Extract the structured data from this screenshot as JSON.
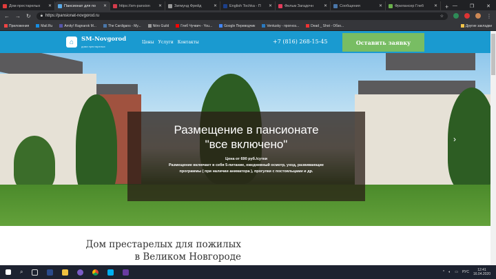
{
  "browser": {
    "tabs": [
      {
        "label": "Дом престарелых",
        "color": "#e03b3b",
        "active": false
      },
      {
        "label": "Пансионат для по",
        "color": "#5aa9e6",
        "active": true
      },
      {
        "label": "https://sm-pansion",
        "color": "#d23b4b",
        "active": false
      },
      {
        "label": "Зигмунд Фрейд",
        "color": "#999999",
        "active": false
      },
      {
        "label": "English Tochka - П",
        "color": "#1c3f8a",
        "active": false
      },
      {
        "label": "Фильм Загадочн",
        "color": "#e33c5b",
        "active": false
      },
      {
        "label": "Сообщения",
        "color": "#4a76a8",
        "active": false
      },
      {
        "label": "Фрилансер Глеб",
        "color": "#6ab04c",
        "active": false
      }
    ],
    "url": "https://pansionat-novgorod.ru",
    "bookmarks": [
      {
        "label": "Приложения",
        "color": "#e44"
      },
      {
        "label": "Mail.Ru",
        "color": "#168de2"
      },
      {
        "label": "Amity! Ragnarok M...",
        "color": "#55a"
      },
      {
        "label": "The Cardigans - My...",
        "color": "#4a76a8"
      },
      {
        "label": "Nitro Guild",
        "color": "#999"
      },
      {
        "label": "Глеб Чучвич - You...",
        "color": "#f00"
      },
      {
        "label": "Google Переводчик",
        "color": "#4285f4"
      },
      {
        "label": "Ventusky - прогноз...",
        "color": "#2a7ac0"
      },
      {
        "label": "Dead _ Shot - Обзо...",
        "color": "#e33"
      }
    ],
    "other_bookmarks": "Другие закладки"
  },
  "site": {
    "brand": "SM-Novgorod",
    "brand_sub": "дома престарелых",
    "nav": [
      "Цены",
      "Услуги",
      "Контакты"
    ],
    "phone": "+7 (816) 268-15-45",
    "cta": "Оставить заявку",
    "hero": {
      "title_line1": "Размещение в пансионате",
      "title_line2": "\"все включено\"",
      "price": "Цена от 690 руб./сутки",
      "desc_line1": "Размещение включает в себя 5-питание, ежедневный осмотр, уход, развивающие",
      "desc_line2": "программы ( при наличии аниматора ), прогулки с постояльцами и др."
    },
    "section_title_line1": "Дом престарелых для пожилых",
    "section_title_line2": "в Великом Новгороде"
  },
  "taskbar": {
    "lang": "РУС",
    "time": "12:41",
    "date": "16.04.2020"
  }
}
